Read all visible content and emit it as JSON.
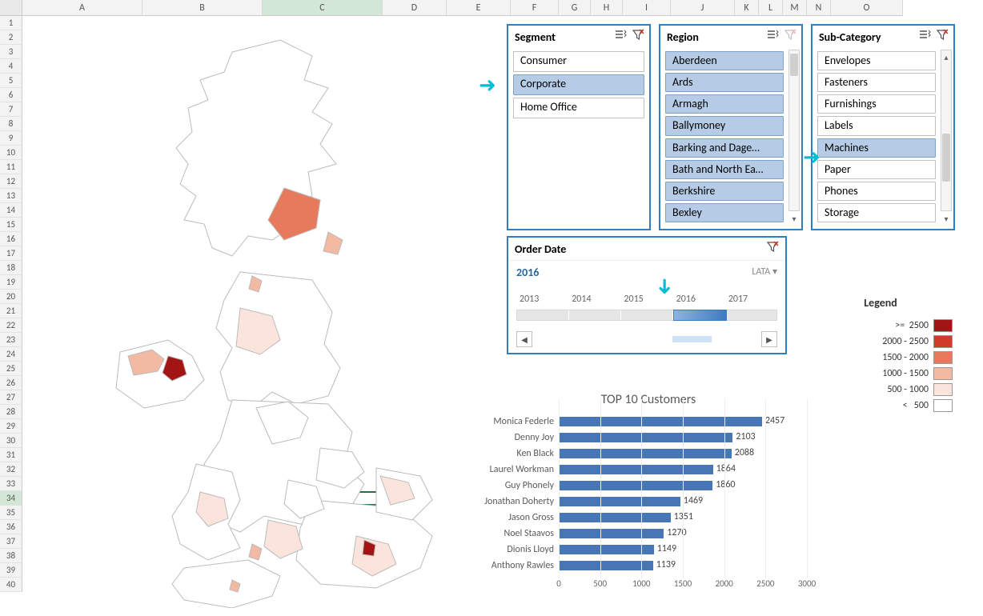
{
  "columns": [
    {
      "letter": "A",
      "width": 150
    },
    {
      "letter": "B",
      "width": 150
    },
    {
      "letter": "C",
      "width": 150
    },
    {
      "letter": "D",
      "width": 80
    },
    {
      "letter": "E",
      "width": 80
    },
    {
      "letter": "F",
      "width": 60
    },
    {
      "letter": "G",
      "width": 40
    },
    {
      "letter": "H",
      "width": 40
    },
    {
      "letter": "I",
      "width": 60
    },
    {
      "letter": "J",
      "width": 80
    },
    {
      "letter": "K",
      "width": 30
    },
    {
      "letter": "L",
      "width": 30
    },
    {
      "letter": "M",
      "width": 30
    },
    {
      "letter": "N",
      "width": 30
    },
    {
      "letter": "O",
      "width": 90
    }
  ],
  "selected_column": "C",
  "selected_row": 34,
  "row_count": 40,
  "slicers": {
    "segment": {
      "title": "Segment",
      "items": [
        {
          "label": "Consumer",
          "selected": false
        },
        {
          "label": "Corporate",
          "selected": true
        },
        {
          "label": "Home Office",
          "selected": false
        }
      ],
      "has_scrollbar": false,
      "filter_active": true
    },
    "region": {
      "title": "Region",
      "items": [
        {
          "label": "Aberdeen",
          "selected": true
        },
        {
          "label": "Ards",
          "selected": true
        },
        {
          "label": "Armagh",
          "selected": true
        },
        {
          "label": "Ballymoney",
          "selected": true
        },
        {
          "label": "Barking and Dage…",
          "selected": true
        },
        {
          "label": "Bath and North Ea…",
          "selected": true
        },
        {
          "label": "Berkshire",
          "selected": true
        },
        {
          "label": "Bexley",
          "selected": true
        }
      ],
      "has_scrollbar": true,
      "thumb": {
        "top": 4,
        "height": 28
      },
      "filter_active": false
    },
    "subcategory": {
      "title": "Sub-Category",
      "items": [
        {
          "label": "Envelopes",
          "selected": false
        },
        {
          "label": "Fasteners",
          "selected": false
        },
        {
          "label": "Furnishings",
          "selected": false
        },
        {
          "label": "Labels",
          "selected": false
        },
        {
          "label": "Machines",
          "selected": true
        },
        {
          "label": "Paper",
          "selected": false
        },
        {
          "label": "Phones",
          "selected": false
        },
        {
          "label": "Storage",
          "selected": false
        }
      ],
      "has_scrollbar": true,
      "thumb": {
        "top": 104,
        "height": 60
      },
      "filter_active": true
    }
  },
  "timeline": {
    "title": "Order Date",
    "selected_label": "2016",
    "period_label": "LATA",
    "years": [
      "2013",
      "2014",
      "2015",
      "2016",
      "2017"
    ],
    "selected_index": 3,
    "filter_active": true
  },
  "legend": {
    "title": "Legend",
    "rows": [
      {
        "label": ">=  2500",
        "color": "#a31515"
      },
      {
        "label": "2000 - 2500",
        "color": "#d13b2a"
      },
      {
        "label": "1500 - 2000",
        "color": "#e77a5c"
      },
      {
        "label": "1000 - 1500",
        "color": "#f2b9a3"
      },
      {
        "label": "500 - 1000",
        "color": "#fbe4db"
      },
      {
        "label": "<   500",
        "color": "#ffffff"
      }
    ]
  },
  "chart_data": {
    "type": "bar",
    "title": "TOP 10 Customers",
    "categories": [
      "Monica Federle",
      "Denny Joy",
      "Ken Black",
      "Laurel Workman",
      "Guy Phonely",
      "Jonathan Doherty",
      "Jason Gross",
      "Noel Staavos",
      "Dionis Lloyd",
      "Anthony Rawles"
    ],
    "values": [
      2457,
      2103,
      2088,
      1864,
      1860,
      1469,
      1351,
      1270,
      1149,
      1139
    ],
    "xlim": [
      0,
      3000
    ],
    "xticks": [
      0,
      500,
      1000,
      1500,
      2000,
      2500,
      3000
    ],
    "xlabel": "",
    "ylabel": ""
  }
}
